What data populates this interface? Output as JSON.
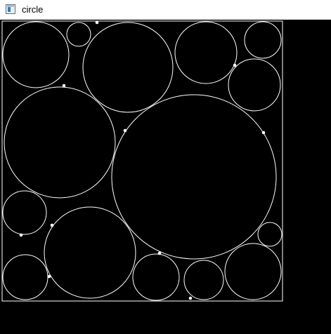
{
  "window": {
    "title": "circle",
    "icon": "app-window-icon"
  },
  "canvas": {
    "background_color": "#000000",
    "stroke_color": "#ffffff",
    "point_color": "#ffffff"
  }
}
